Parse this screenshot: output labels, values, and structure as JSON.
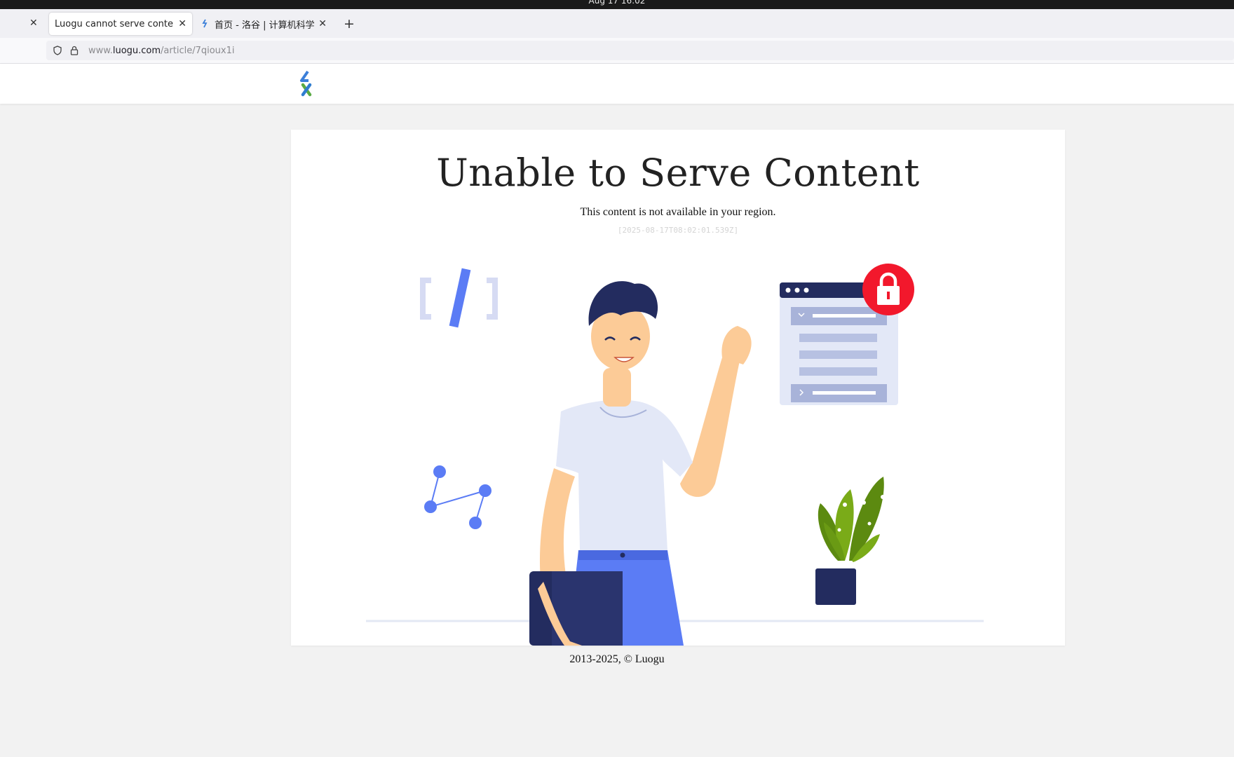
{
  "os": {
    "clock": "Aug 17  16:02"
  },
  "browser": {
    "tabs": [
      {
        "label": "Luogu cannot serve content",
        "active": true
      },
      {
        "label": "首页 - 洛谷 | 计算机科学教育新生态",
        "active": false
      }
    ],
    "url": {
      "prefix": "www.",
      "host": "luogu.com",
      "path": "/article/7qioux1i"
    }
  },
  "page": {
    "title": "Unable to Serve Content",
    "message": "This content is not available in your region.",
    "timestamp": "[2025-08-17T08:02:01.539Z]",
    "footer": "2013-2025, © Luogu"
  },
  "colors": {
    "accent_blue": "#5b7cf5",
    "navy": "#232c5f",
    "lock_red": "#f2182c",
    "page_bg": "#f2f2f2"
  },
  "icons": [
    "close-icon",
    "plus-icon",
    "shield-icon",
    "lock-icon",
    "luogu-logo"
  ]
}
